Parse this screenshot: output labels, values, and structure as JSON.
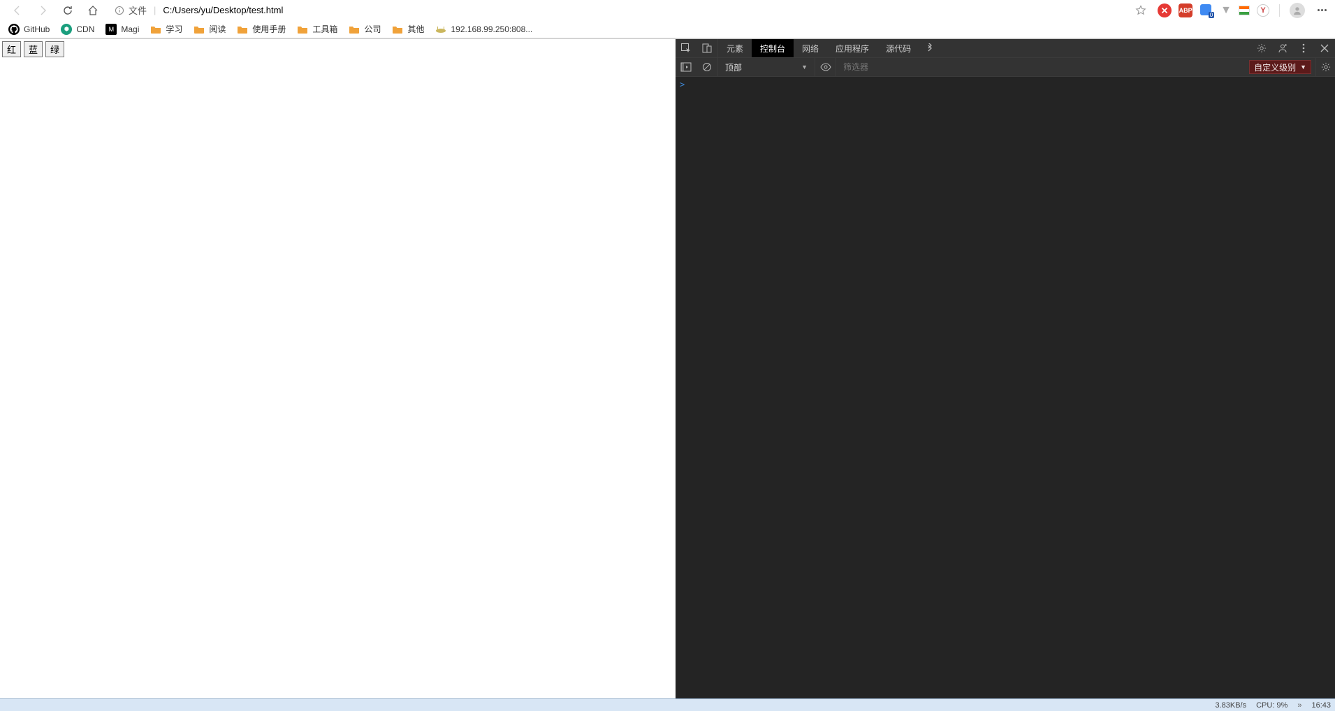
{
  "toolbar": {
    "protocol_label": "文件",
    "url": "C:/Users/yu/Desktop/test.html"
  },
  "bookmarks": [
    {
      "label": "GitHub",
      "icon": "github"
    },
    {
      "label": "CDN",
      "icon": "cdn"
    },
    {
      "label": "Magi",
      "icon": "magi"
    },
    {
      "label": "学习",
      "icon": "folder"
    },
    {
      "label": "阅读",
      "icon": "folder"
    },
    {
      "label": "使用手册",
      "icon": "folder"
    },
    {
      "label": "工具箱",
      "icon": "folder"
    },
    {
      "label": "公司",
      "icon": "folder"
    },
    {
      "label": "其他",
      "icon": "folder"
    },
    {
      "label": "192.168.99.250:808...",
      "icon": "router"
    }
  ],
  "page": {
    "buttons": [
      "红",
      "蓝",
      "绿"
    ]
  },
  "devtools": {
    "tabs": [
      "元素",
      "控制台",
      "网络",
      "应用程序",
      "源代码"
    ],
    "active_tab": "控制台",
    "context_label": "顶部",
    "filter_placeholder": "筛选器",
    "level_label": "自定义级别",
    "prompt": ">"
  },
  "extensions": {
    "badge_count": "0"
  },
  "taskbar": {
    "net_speed": "3.83KB/s",
    "cpu_label": "CPU: 9%",
    "clock": "16:43"
  }
}
